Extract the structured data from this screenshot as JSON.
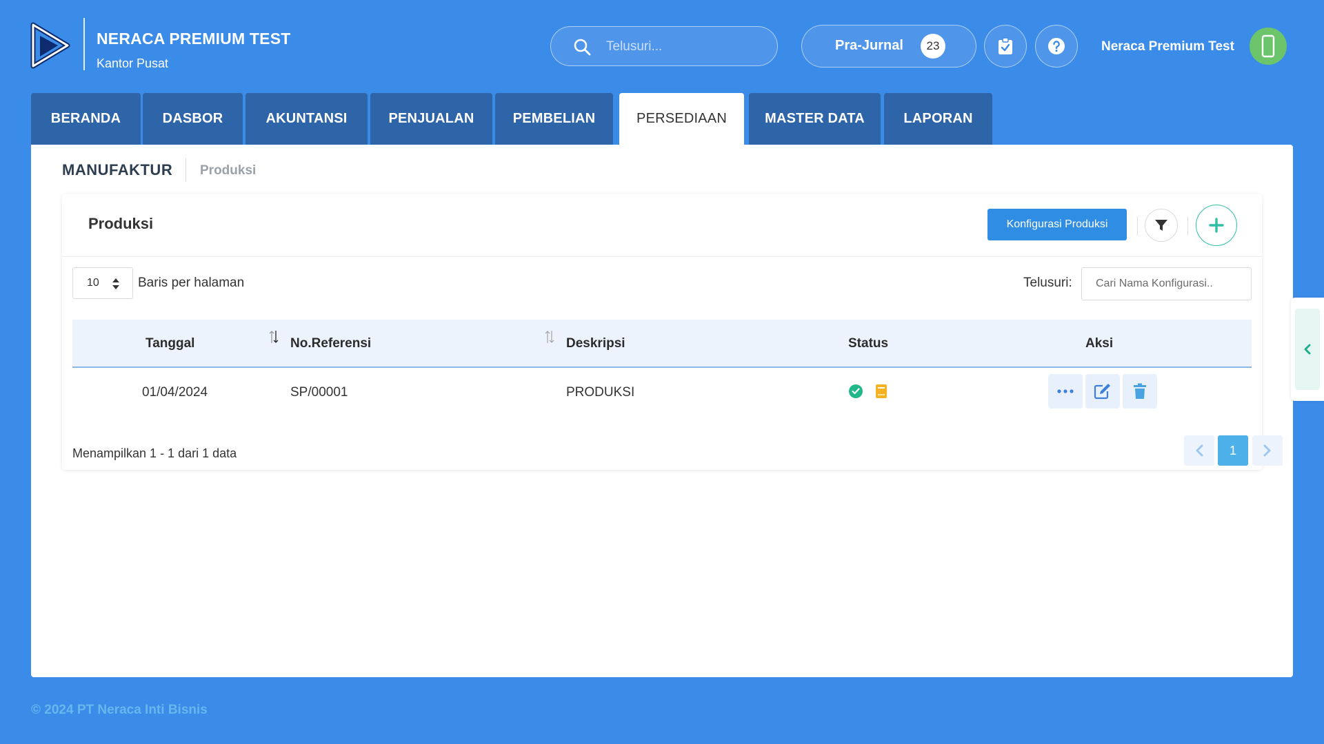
{
  "header": {
    "company_name": "NERACA PREMIUM TEST",
    "branch_name": "Kantor Pusat",
    "search_placeholder": "Telusuri...",
    "prajurnal_label": "Pra-Jurnal",
    "prajurnal_count": "23",
    "user_name": "Neraca Premium Test",
    "logo_icon": "play-logo-icon",
    "clipboard_icon": "clipboard-check-icon",
    "help_icon": "help-icon",
    "avatar_icon": "phone-icon"
  },
  "tabs": [
    {
      "label": "BERANDA",
      "active": false
    },
    {
      "label": "DASBOR",
      "active": false
    },
    {
      "label": "AKUNTANSI",
      "active": false
    },
    {
      "label": "PENJUALAN",
      "active": false
    },
    {
      "label": "PEMBELIAN",
      "active": false
    },
    {
      "label": "PERSEDIAAN",
      "active": true
    },
    {
      "label": "MASTER DATA",
      "active": false
    },
    {
      "label": "LAPORAN",
      "active": false
    }
  ],
  "breadcrumb": {
    "title": "MANUFAKTUR",
    "sub": "Produksi"
  },
  "card": {
    "title": "Produksi",
    "config_button": "Konfigurasi Produksi"
  },
  "table_controls": {
    "rows_per_page_value": "10",
    "rows_per_page_label": "Baris per halaman",
    "search_label": "Telusuri:",
    "search_placeholder": "Cari Nama Konfigurasi.."
  },
  "table": {
    "columns": [
      "Tanggal",
      "No.Referensi",
      "Deskripsi",
      "Status",
      "Aksi"
    ],
    "rows": [
      {
        "tanggal": "01/04/2024",
        "no_referensi": "SP/00001",
        "deskripsi": "PRODUKSI"
      }
    ]
  },
  "pagination": {
    "info": "Menampilkan 1 - 1 dari 1 data",
    "current_page": "1"
  },
  "footer": {
    "copyright": "© 2024 PT Neraca Inti Bisnis"
  },
  "colors": {
    "background": "#3b8be8",
    "tab": "#2e64a8",
    "primary_button": "#2f8de4",
    "accent_green": "#2fbfa6",
    "status_ok": "#21b788",
    "status_book": "#f5b324"
  }
}
